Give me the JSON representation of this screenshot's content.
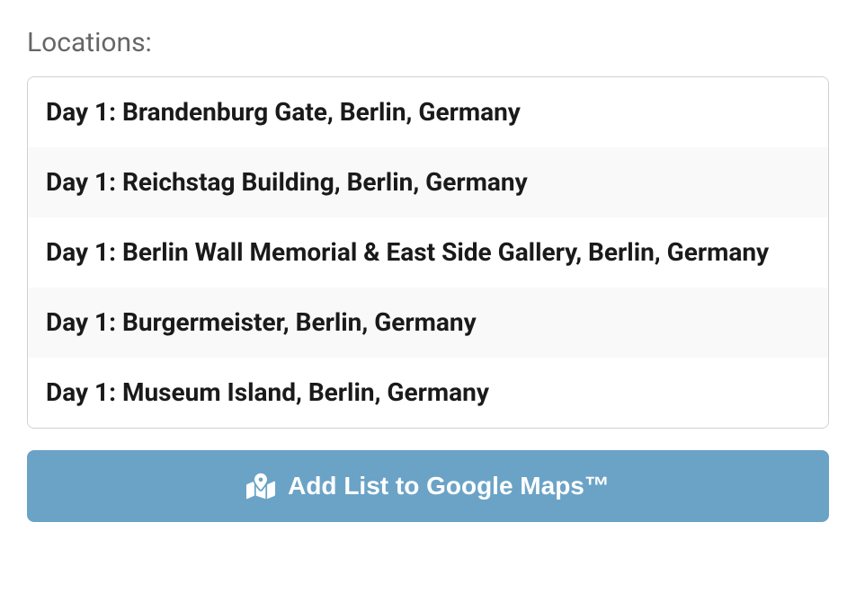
{
  "section": {
    "title": "Locations:"
  },
  "locations": [
    "Day 1: Brandenburg Gate, Berlin, Germany",
    "Day 1: Reichstag Building, Berlin, Germany",
    "Day 1: Berlin Wall Memorial & East Side Gallery, Berlin, Germany",
    "Day 1: Burgermeister, Berlin, Germany",
    "Day 1: Museum Island, Berlin, Germany"
  ],
  "button": {
    "label": "Add List to Google Maps™"
  }
}
